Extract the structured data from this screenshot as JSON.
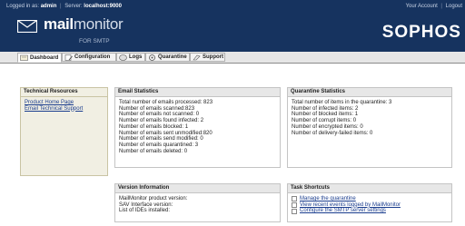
{
  "topbar": {
    "logged_in_label": "Logged in as:",
    "user": "admin",
    "server_label": "Server:",
    "server": "localhost:9000",
    "your_account": "Your Account",
    "logout": "Logout"
  },
  "logo": {
    "mail": "mail",
    "monitor": "monitor",
    "subtitle": "FOR SMTP",
    "brand": "SOPHOS"
  },
  "tabs": [
    {
      "label": "Dashboard",
      "icon": "dashboard-icon"
    },
    {
      "label": "Configuration",
      "icon": "configuration-icon"
    },
    {
      "label": "Logs",
      "icon": "logs-icon"
    },
    {
      "label": "Quarantine",
      "icon": "quarantine-icon"
    },
    {
      "label": "Support",
      "icon": "support-icon"
    }
  ],
  "tech_resources": {
    "title": "Technical Resources",
    "links": [
      "Product Home Page",
      "Email Technical Support"
    ]
  },
  "email_stats": {
    "title": "Email Statistics",
    "lines": [
      "Total number of emails processed: 823",
      "Number of emails scanned:823",
      "Number of emails not scanned: 0",
      "Number of emails found infected: 2",
      "Number of emails blocked: 1",
      "Number of emails sent unmodified:820",
      "Number of emails send modified: 0",
      "Number of emails quarantined: 3",
      "Number of emails deleted: 0"
    ]
  },
  "quarantine_stats": {
    "title": "Quarantine Statistics",
    "lines": [
      "Total number of items in the quarantine: 3",
      "Number of infected items: 2",
      "Number of blocked items: 1",
      "Number of corrupt items: 0",
      "Number of encrypted items: 0",
      "Number of delivery-failed items: 0"
    ]
  },
  "version_info": {
    "title": "Version Information",
    "lines": [
      "MailMonitor product version:",
      "SAV Interface version:",
      "List of IDEs installed:"
    ]
  },
  "task_shortcuts": {
    "title": "Task Shortcuts",
    "links": [
      "Manage the quarantine",
      "View recent events logged by MailMonitor",
      "Configure the SMTP server settings"
    ]
  },
  "colors": {
    "header": "#16335f",
    "tab_bar": "#e6e6e6",
    "panel_header": "#e7e7e7",
    "tech_panel": "#f1efe3",
    "link": "#1a3d8e"
  }
}
